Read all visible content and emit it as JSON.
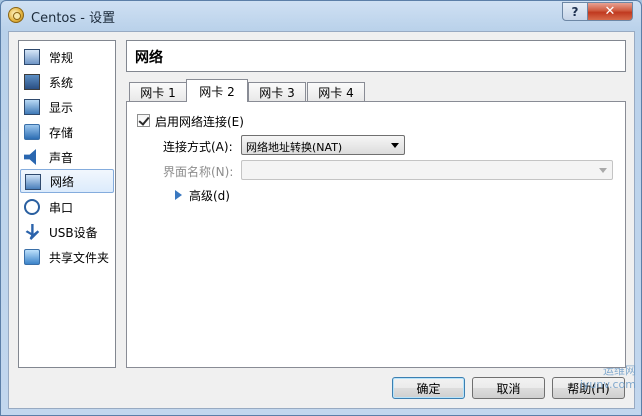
{
  "window": {
    "title": "Centos - 设置"
  },
  "caption_buttons": {
    "help": "?",
    "close": "✕"
  },
  "sidebar": {
    "items": [
      {
        "label": "常规",
        "icon": "general-icon"
      },
      {
        "label": "系统",
        "icon": "system-icon"
      },
      {
        "label": "显示",
        "icon": "display-icon"
      },
      {
        "label": "存储",
        "icon": "storage-icon"
      },
      {
        "label": "声音",
        "icon": "audio-icon"
      },
      {
        "label": "网络",
        "icon": "network-icon",
        "selected": true
      },
      {
        "label": "串口",
        "icon": "serial-port-icon"
      },
      {
        "label": "USB设备",
        "icon": "usb-icon"
      },
      {
        "label": "共享文件夹",
        "icon": "shared-folder-icon"
      }
    ]
  },
  "page": {
    "title": "网络"
  },
  "tabs": [
    {
      "label": "网卡 1"
    },
    {
      "label": "网卡 2",
      "active": true
    },
    {
      "label": "网卡 3"
    },
    {
      "label": "网卡 4"
    }
  ],
  "adapter": {
    "enable_label": "启用网络连接(E)",
    "enabled": true,
    "attached_to_label": "连接方式(A):",
    "attached_to_value": "网络地址转换(NAT)",
    "name_label": "界面名称(N):",
    "name_value": "",
    "advanced_label": "高级(d)"
  },
  "buttons": {
    "ok": "确定",
    "cancel": "取消",
    "help": "帮助(H)"
  },
  "watermark": {
    "line1": "运维网",
    "line2": "iyunv.com"
  },
  "colors": {
    "accent": "#3a78c0",
    "selection": "#dcebfc",
    "close": "#c0391f"
  }
}
